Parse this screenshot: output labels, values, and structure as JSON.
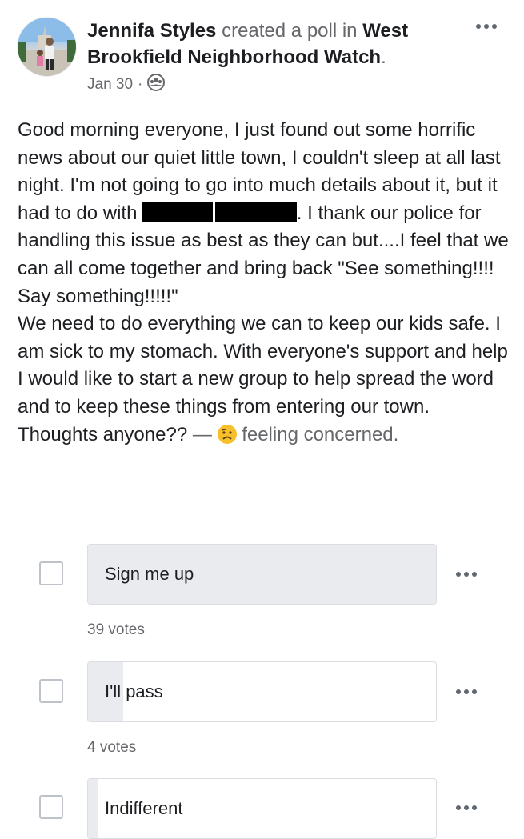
{
  "post": {
    "author": "Jennifa Styles",
    "action": "created a poll in",
    "group": "West Brookfield Neighborhood Watch",
    "date": "Jan 30",
    "separator": "·",
    "audience_icon": "group-audience-icon",
    "body": {
      "line1": "Good morning everyone, I just found out some horrific news about our quiet little town, I couldn't sleep at all last night. I'm not going to go into much details about it, but it had to do with",
      "line2": ". I thank our police for handling this issue as best as they can but....I feel that we can all come together and bring back \"See something!!!! Say something!!!!!\"",
      "line3": "We need to do everything we can to keep our kids safe. I am sick to my stomach. With everyone's support and help I would like to start a new group to help spread the word and to keep these things from entering our town.",
      "line4": "Thoughts anyone??",
      "dash": "—",
      "feeling": "feeling concerned.",
      "feeling_icon": "worried-face-emoji"
    }
  },
  "poll": {
    "options": [
      {
        "label": "Sign me up",
        "votes": "39 votes",
        "share": 1.0
      },
      {
        "label": "I'll pass",
        "votes": "4 votes",
        "share": 0.1
      },
      {
        "label": "Indifferent",
        "votes": "",
        "share": 0.03
      }
    ]
  },
  "colors": {
    "text": "#1c1e21",
    "secondary": "#65676b",
    "poll_fill": "#e9ebee",
    "poll_border": "#dadde1",
    "checkbox_border": "#bec3c9"
  }
}
